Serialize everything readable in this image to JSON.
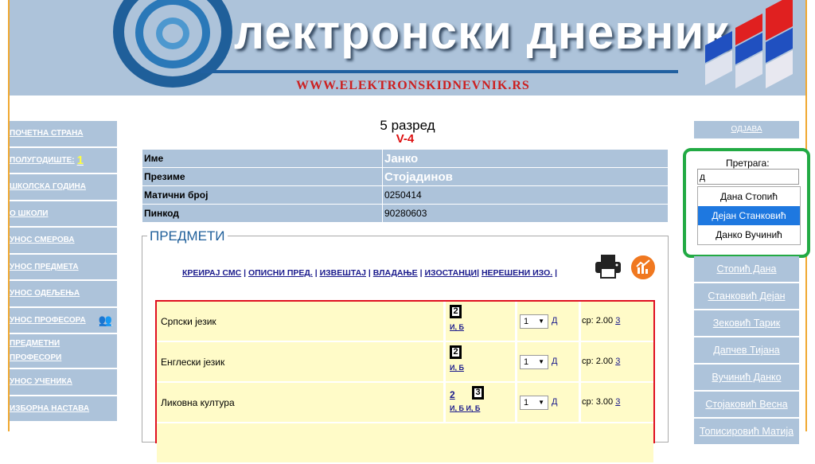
{
  "banner": {
    "title": "лектронски дневник",
    "url": "WWW.ELEKTRONSKIDNEVNIK.RS"
  },
  "sidebar": {
    "items": [
      {
        "label": "ПОЧЕТНА СТРАНА"
      },
      {
        "label": "ПОЛУГОДИШТЕ:",
        "value": "1"
      },
      {
        "label": "ШКОЛСКА ГОДИНА"
      },
      {
        "label": "О ШКОЛИ"
      },
      {
        "label": "УНОС СМЕРОВА"
      },
      {
        "label": "УНОС ПРЕДМЕТА"
      },
      {
        "label": "УНОС ОДЕЉЕЊА"
      },
      {
        "label": "УНОС ПРОФЕСОРА"
      },
      {
        "label_line1": "ПРЕДМЕТНИ",
        "label_line2": "ПРОФЕСОРИ"
      },
      {
        "label": "УНОС УЧЕНИКА"
      },
      {
        "label": "ИЗБОРНА НАСТАВА"
      }
    ]
  },
  "student": {
    "grade": "5 разред",
    "class": "V-4",
    "rows": [
      {
        "label": "Име",
        "value": "Јанко"
      },
      {
        "label": "Презиме",
        "value": "Стојадинов"
      },
      {
        "label": "Матични број",
        "value": "0250414"
      },
      {
        "label": "Пинкод",
        "value": "90280603"
      }
    ]
  },
  "subjects_section": {
    "legend": "ПРЕДМЕТИ",
    "links": [
      "КРЕИРАЈ СМС",
      "ОПИСНИ ПРЕД.",
      "ИЗВЕШТАЈ",
      "ВЛАДАЊЕ",
      "ИЗОСТАНЦИ",
      "НЕРЕШЕНИ ИЗО."
    ],
    "subjects": [
      {
        "name": "Српски језик",
        "grades_boxed": [
          "2"
        ],
        "ib": "И, Б",
        "select": "1",
        "d": "Д",
        "avg_label": "ср: 2.00",
        "avg_link": "3"
      },
      {
        "name": "Енглески језик",
        "grades_boxed": [
          "2"
        ],
        "ib": "И, Б",
        "select": "1",
        "d": "Д",
        "avg_label": "ср: 2.00",
        "avg_link": "3"
      },
      {
        "name": "Ликовна култура",
        "grade_plain": "2",
        "grades_boxed": [
          "3"
        ],
        "ib": "И, Б И, Б",
        "select": "1",
        "d": "Д",
        "avg_label": "ср: 3.00",
        "avg_link": "3"
      }
    ]
  },
  "right": {
    "logout": "ОДЈАВА",
    "search_label": "Претрага:",
    "search_value": "д",
    "suggestions": [
      "Дана Стопић",
      "Дејан Станковић",
      "Данко Вучинић"
    ],
    "selected_suggestion": "Дејан Станковић",
    "names": [
      "Стопић Дана",
      "Станковић Дејан",
      "Зековић Тарик",
      "Дапчев Тијана",
      "Вучинић Данко",
      "Стојаковић Весна",
      "Тописировић Матија"
    ]
  },
  "colors": {
    "sidebar_bg": "#adc3da",
    "subject_bg": "#fffbc8",
    "highlight_border": "#22aa44",
    "subjects_border": "#e01020",
    "selected": "#1e78e0"
  }
}
